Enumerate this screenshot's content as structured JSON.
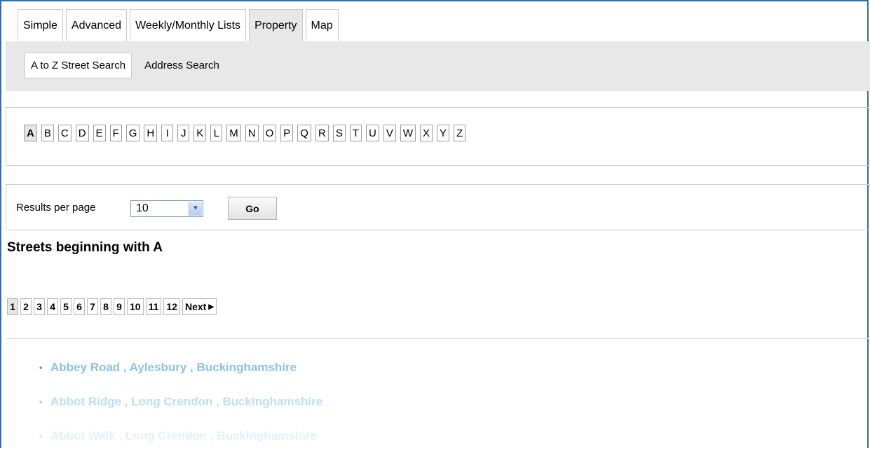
{
  "tabs": [
    "Simple",
    "Advanced",
    "Weekly/Monthly Lists",
    "Property",
    "Map"
  ],
  "active_tab": "Property",
  "subtabs": [
    "A to Z Street Search",
    "Address Search"
  ],
  "active_subtab": "A to Z Street Search",
  "letters": [
    "A",
    "B",
    "C",
    "D",
    "E",
    "F",
    "G",
    "H",
    "I",
    "J",
    "K",
    "L",
    "M",
    "N",
    "O",
    "P",
    "Q",
    "R",
    "S",
    "T",
    "U",
    "V",
    "W",
    "X",
    "Y",
    "Z"
  ],
  "active_letter": "A",
  "results_per_page": {
    "label": "Results per page",
    "value": "10",
    "go_label": "Go"
  },
  "heading": "Streets beginning with A",
  "pagination": {
    "pages": [
      "1",
      "2",
      "3",
      "4",
      "5",
      "6",
      "7",
      "8",
      "9",
      "10",
      "11",
      "12"
    ],
    "current": "1",
    "next_label": "Next"
  },
  "results": [
    "Abbey Road , Aylesbury , Buckinghamshire",
    "Abbot Ridge , Long Crendon , Buckinghamshire",
    "Abbot Walk , Long Crendon , Buckinghamshire"
  ],
  "colors": {
    "frame": "#2f6fb0",
    "link": "#8cc2e6",
    "panel": "#e8e8e8"
  }
}
